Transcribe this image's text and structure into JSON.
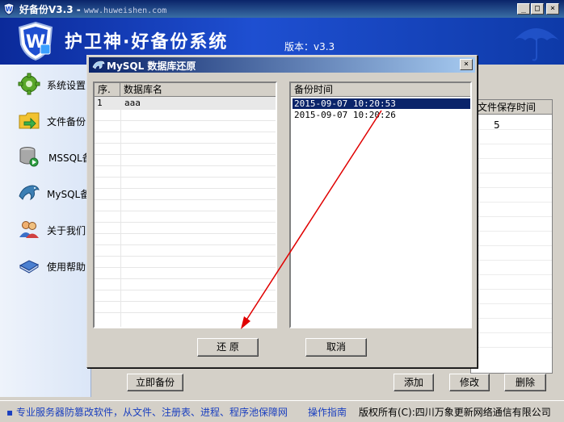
{
  "window": {
    "title": "好备份V3.3 - ",
    "url": "www.huweishen.com",
    "min": "_",
    "max": "□",
    "close": "×"
  },
  "header": {
    "title": "护卫神·好备份系统",
    "version": "版本：v3.3"
  },
  "sidebar": {
    "items": [
      {
        "label": "系统设置",
        "icon": "gear-icon"
      },
      {
        "label": "文件备份",
        "icon": "folder-icon"
      },
      {
        "label": "MSSQL备份",
        "icon": "database-icon"
      },
      {
        "label": "MySQL备份",
        "icon": "dolphin-icon"
      },
      {
        "label": "关于我们",
        "icon": "users-icon"
      },
      {
        "label": "使用帮助",
        "icon": "book-icon"
      }
    ]
  },
  "main": {
    "list_header": "文件保存时间",
    "list_value": "5",
    "buttons": {
      "backup_now": "立即备份",
      "add": "添加",
      "edit": "修改",
      "delete": "删除"
    }
  },
  "dialog": {
    "title": "MySQL 数据库还原",
    "close": "×",
    "db_list": {
      "columns": [
        "序.",
        "数据库名"
      ],
      "rows": [
        {
          "index": "1",
          "name": "aaa"
        }
      ]
    },
    "time_list": {
      "column": "备份时间",
      "rows": [
        "2015-09-07 10:20:53",
        "2015-09-07 10:20:26"
      ],
      "selected_index": 0
    },
    "buttons": {
      "restore": "还 原",
      "cancel": "取消"
    }
  },
  "statusbar": {
    "promo": "专业服务器防篡改软件，从文件、注册表、进程、程序池保障网",
    "guide": "操作指南",
    "copyright": "版权所有(C):四川万象更新网络通信有限公司"
  },
  "colors": {
    "title_blue": "#0a246a",
    "banner_blue": "#1e4fd1",
    "selection": "#0a246a",
    "arrow": "#e00000",
    "status_link": "#1a3fbf"
  }
}
